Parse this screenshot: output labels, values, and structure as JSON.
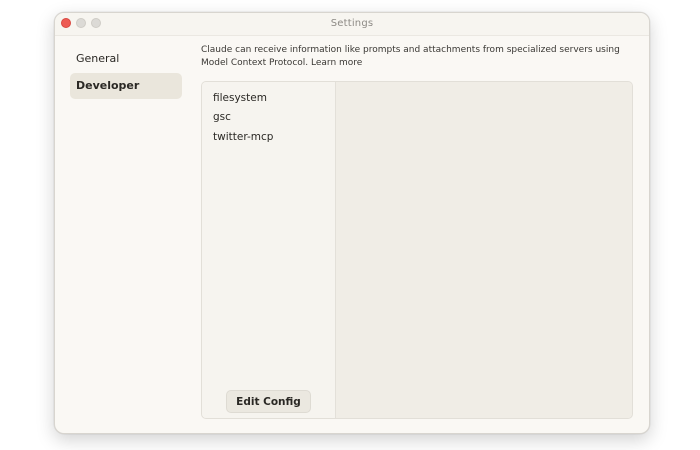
{
  "window": {
    "title": "Settings"
  },
  "sidebar": {
    "items": [
      {
        "label": "General",
        "active": false
      },
      {
        "label": "Developer",
        "active": true
      }
    ]
  },
  "developer": {
    "description": "Claude can receive information like prompts and attachments from specialized servers using Model Context Protocol.",
    "learn_more": "Learn more",
    "servers": [
      "filesystem",
      "gsc",
      "twitter-mcp"
    ],
    "edit_config_label": "Edit Config"
  },
  "colors": {
    "close_button": "#ed5b54",
    "active_nav_bg": "#eae6dc",
    "window_bg": "#faf8f4",
    "panel_bg": "#f0ede6"
  }
}
